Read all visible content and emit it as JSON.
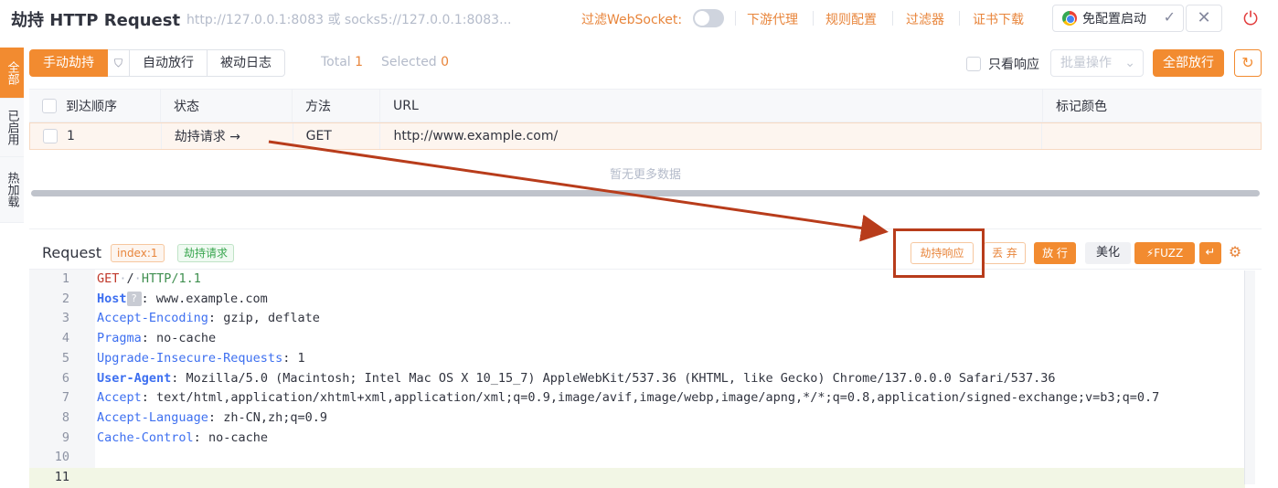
{
  "header": {
    "title": "劫持 HTTP Request",
    "proxy_address": "http://127.0.0.1:8083 或 socks5://127.0.0.1:8083...",
    "filter_websocket_label": "过滤WebSocket:",
    "links": [
      "下游代理",
      "规则配置",
      "过滤器",
      "证书下载"
    ],
    "chrome_button": "免配置启动",
    "icons": [
      "chrome-icon",
      "check-icon",
      "close-icon",
      "power-icon"
    ]
  },
  "sidebar": {
    "tabs": [
      "全部",
      "已启用",
      "热加载"
    ],
    "active": "全部"
  },
  "toolbar": {
    "modes": [
      "手动劫持",
      "自动放行",
      "被动日志"
    ],
    "total_label": "Total",
    "total_value": "1",
    "selected_label": "Selected",
    "selected_value": "0",
    "only_response_label": "只看响应",
    "batch_label": "批量操作",
    "release_all_label": "全部放行"
  },
  "table": {
    "columns": [
      "到达顺序",
      "状态",
      "方法",
      "URL",
      "标记颜色"
    ],
    "rows": [
      {
        "order": "1",
        "status": "劫持请求 →",
        "method": "GET",
        "url": "http://www.example.com/",
        "color": ""
      }
    ],
    "empty_text": "暂无更多数据"
  },
  "request": {
    "title": "Request",
    "index_tag": "index:1",
    "status_tag": "劫持请求",
    "buttons": {
      "hold_response": "劫持响应",
      "discard": "丢 弃",
      "forward": "放 行",
      "beautify": "美化",
      "fuzz": "FUZZ"
    },
    "lines": [
      {
        "n": "1",
        "text": "GET / HTTP/1.1"
      },
      {
        "n": "2",
        "key": "Host",
        "value": " www.example.com"
      },
      {
        "n": "3",
        "key": "Accept-Encoding",
        "value": " gzip, deflate"
      },
      {
        "n": "4",
        "key": "Pragma",
        "value": " no-cache"
      },
      {
        "n": "5",
        "key": "Upgrade-Insecure-Requests",
        "value": " 1"
      },
      {
        "n": "6",
        "key": "User-Agent",
        "value": " Mozilla/5.0 (Macintosh; Intel Mac OS X 10_15_7) AppleWebKit/537.36 (KHTML, like Gecko) Chrome/137.0.0.0 Safari/537.36"
      },
      {
        "n": "7",
        "key": "Accept",
        "value": " text/html,application/xhtml+xml,application/xml;q=0.9,image/avif,image/webp,image/apng,*/*;q=0.8,application/signed-exchange;v=b3;q=0.7"
      },
      {
        "n": "8",
        "key": "Accept-Language",
        "value": " zh-CN,zh;q=0.9"
      },
      {
        "n": "9",
        "key": "Cache-Control",
        "value": " no-cache"
      },
      {
        "n": "10",
        "text": ""
      },
      {
        "n": "11",
        "text": ""
      }
    ]
  },
  "colors": {
    "accent": "#f28b30",
    "annotation": "#b83c1b"
  }
}
